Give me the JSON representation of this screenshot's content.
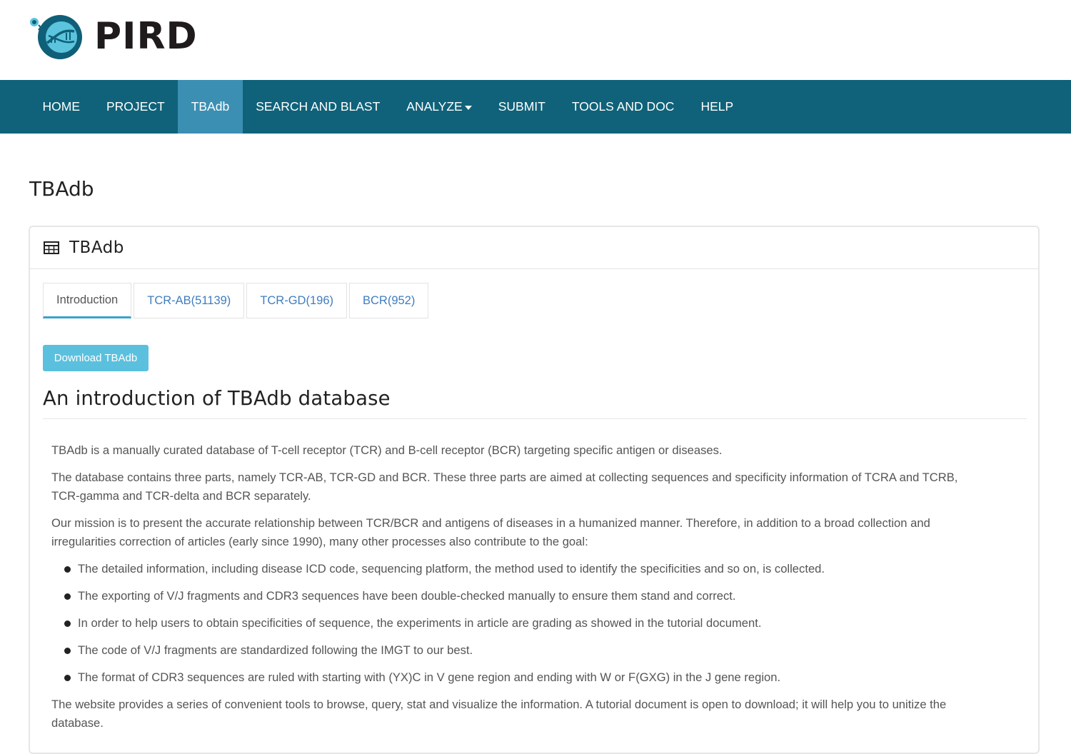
{
  "brand": {
    "name": "PIRD",
    "logo_icon": "dna-globe-icon",
    "colors": {
      "logo_dark": "#0f5f78",
      "logo_light": "#5cc4dd"
    }
  },
  "navbar": {
    "background": "#0f6279",
    "active_background": "#3b8fb3",
    "items": [
      {
        "label": "HOME",
        "active": false
      },
      {
        "label": "PROJECT",
        "active": false
      },
      {
        "label": "TBAdb",
        "active": true
      },
      {
        "label": "SEARCH AND BLAST",
        "active": false
      },
      {
        "label": "ANALYZE",
        "active": false,
        "dropdown": true
      },
      {
        "label": "SUBMIT",
        "active": false
      },
      {
        "label": "TOOLS AND DOC",
        "active": false
      },
      {
        "label": "HELP",
        "active": false
      }
    ]
  },
  "page": {
    "title": "TBAdb"
  },
  "panel": {
    "icon": "table-icon",
    "title": "TBAdb",
    "tabs": [
      {
        "label": "Introduction",
        "active": true
      },
      {
        "label": "TCR-AB(51139)",
        "active": false
      },
      {
        "label": "TCR-GD(196)",
        "active": false
      },
      {
        "label": "BCR(952)",
        "active": false
      }
    ],
    "download_button": "Download TBAdb",
    "section_title": "An introduction of TBAdb database",
    "paragraphs": [
      "TBAdb is a manually curated database of T-cell receptor (TCR) and B-cell receptor (BCR) targeting specific antigen or diseases.",
      "The database contains three parts, namely TCR-AB, TCR-GD and BCR. These three parts are aimed at collecting sequences and specificity information of TCRA and TCRB, TCR-gamma and TCR-delta and BCR separately.",
      "Our mission is to present the accurate relationship between TCR/BCR and antigens of diseases in a humanized manner. Therefore, in addition to a broad collection and irregularities correction of articles (early since 1990), many other processes also contribute to the goal:"
    ],
    "bullets": [
      "The detailed information, including disease ICD code, sequencing platform, the method used to identify the specificities and so on, is collected.",
      "The exporting of V/J fragments and CDR3 sequences have been double-checked manually to ensure them stand and correct.",
      "In order to help users to obtain specificities of sequence, the experiments in article are grading as showed in the tutorial document.",
      "The code of V/J fragments are standardized following the IMGT to our best.",
      "The format of CDR3 sequences are ruled with starting with (YX)C in V gene region and ending with W or F(GXG) in the J gene region."
    ],
    "closing_paragraph": "The website provides a series of convenient tools to browse, query, stat and visualize the information. A tutorial document is open to download; it will help you to unitize the database."
  }
}
